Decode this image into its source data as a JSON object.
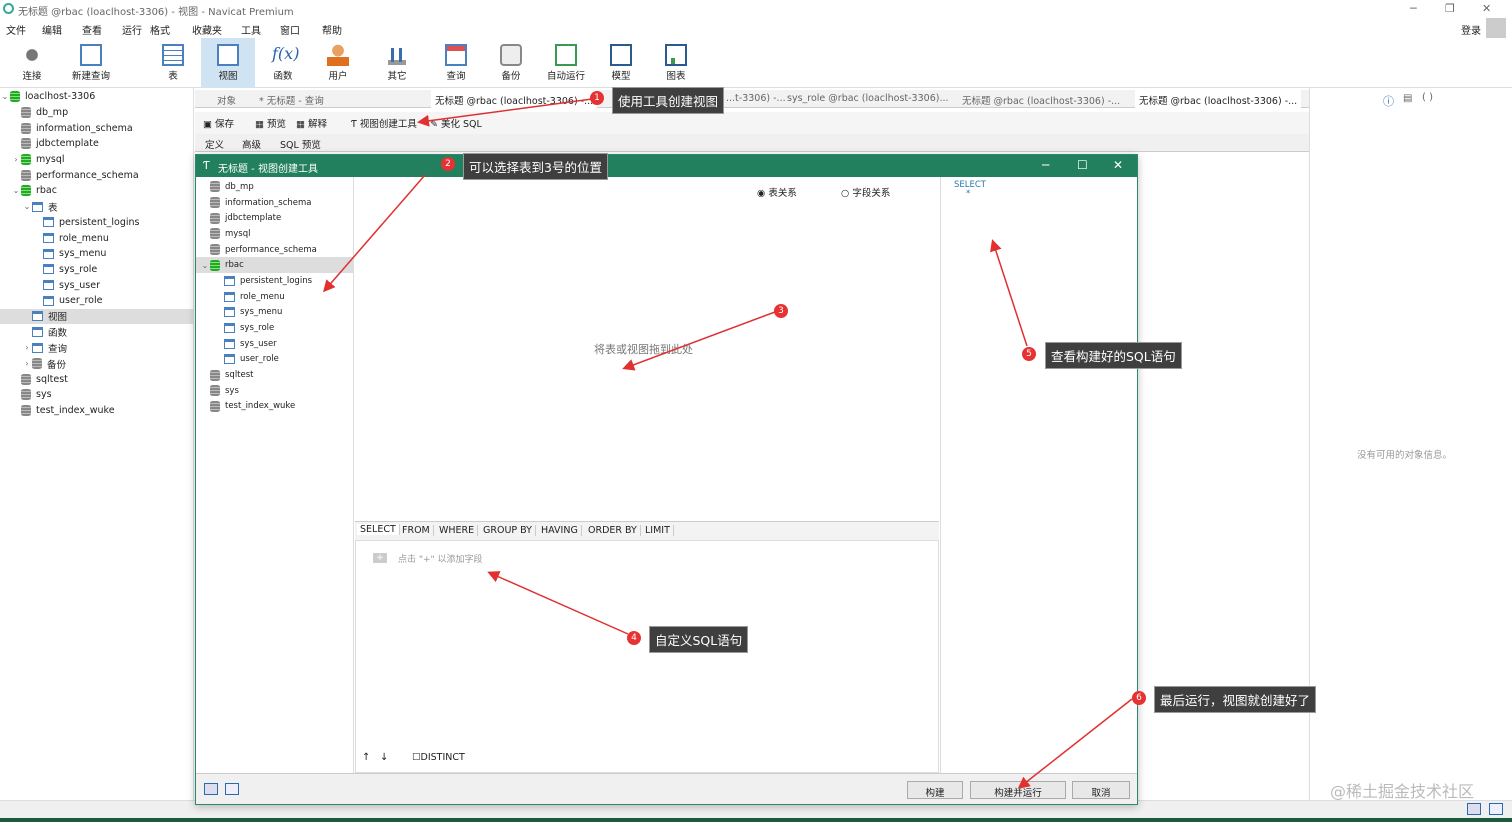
{
  "window": {
    "title": "无标题 @rbac (loaclhost-3306) - 视图 - Navicat Premium"
  },
  "menu": [
    "文件",
    "编辑",
    "查看",
    "运行",
    "格式",
    "收藏夹",
    "工具",
    "窗口",
    "帮助"
  ],
  "login": "登录",
  "toolbar": [
    "连接",
    "新建查询",
    "表",
    "视图",
    "函数",
    "用户",
    "其它",
    "查询",
    "备份",
    "自动运行",
    "模型",
    "图表"
  ],
  "tree": {
    "connection": "loaclhost-3306",
    "dbs_top": [
      "db_mp",
      "information_schema",
      "jdbctemplate",
      "mysql",
      "performance_schema"
    ],
    "rbac": "rbac",
    "table_folder": "表",
    "tables": [
      "persistent_logins",
      "role_menu",
      "sys_menu",
      "sys_role",
      "sys_user",
      "user_role"
    ],
    "view_folder": "视图",
    "func_folder": "函数",
    "query_folder": "查询",
    "backup_folder": "备份",
    "dbs_bottom": [
      "sqltest",
      "sys",
      "test_index_wuke"
    ]
  },
  "tabs": [
    "对象",
    "* 无标题 - 查询",
    "无标题 @rbac (loaclhost-3306) -...",
    "...t-3306) -...",
    "sys_role @rbac (loaclhost-3306)...",
    "无标题 @rbac (loaclhost-3306) -...",
    "无标题 @rbac (loaclhost-3306) -..."
  ],
  "subbar": [
    "保存",
    "预览",
    "解释",
    "视图创建工具",
    "美化 SQL"
  ],
  "deftabs": [
    "定义",
    "高级",
    "SQL 预览"
  ],
  "right_panel": {
    "empty": "没有可用的对象信息。"
  },
  "dialog": {
    "title": "无标题 - 视图创建工具",
    "dbs_top": [
      "db_mp",
      "information_schema",
      "jdbctemplate",
      "mysql",
      "performance_schema"
    ],
    "rbac": "rbac",
    "tables": [
      "persistent_logins",
      "role_menu",
      "sys_menu",
      "sys_role",
      "sys_user",
      "user_role"
    ],
    "dbs_bottom": [
      "sqltest",
      "sys",
      "test_index_wuke"
    ],
    "radio_table": "表关系",
    "radio_field": "字段关系",
    "canvas_hint": "将表或视图拖到此处",
    "sql": "SELECT",
    "sql_dot": "*",
    "clauses": [
      "SELECT",
      "FROM",
      "WHERE",
      "GROUP BY",
      "HAVING",
      "ORDER BY",
      "LIMIT"
    ],
    "add_field": "点击 \"+\" 以添加字段",
    "distinct": "DISTINCT",
    "buttons": [
      "构建",
      "构建并运行",
      "取消"
    ]
  },
  "annotations": [
    {
      "n": "1",
      "text": "使用工具创建视图"
    },
    {
      "n": "2",
      "text": "可以选择表到3号的位置"
    },
    {
      "n": "3",
      "text": ""
    },
    {
      "n": "4",
      "text": "自定义SQL语句"
    },
    {
      "n": "5",
      "text": "查看构建好的SQL语句"
    },
    {
      "n": "6",
      "text": "最后运行，视图就创建好了"
    }
  ],
  "watermark": "@稀土掘金技术社区"
}
